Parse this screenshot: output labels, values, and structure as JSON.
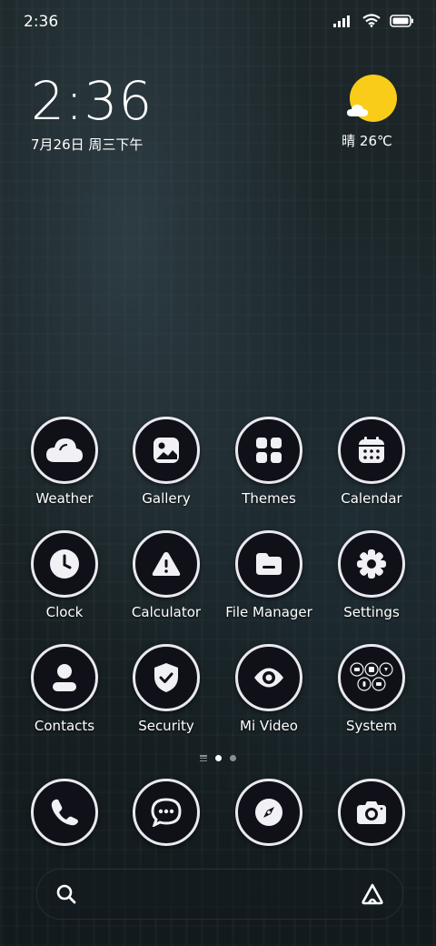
{
  "status_bar": {
    "time": "2:36",
    "icons": [
      "signal-icon",
      "wifi-icon",
      "battery-icon"
    ]
  },
  "clock_widget": {
    "time": "2:36",
    "date": "7月26日 周三下午"
  },
  "weather_widget": {
    "icon": "sunny-partly-cloudy-icon",
    "text": "晴 26℃",
    "sun_color": "#f8cc19"
  },
  "apps": [
    {
      "label": "Weather",
      "icon": "weather-icon"
    },
    {
      "label": "Gallery",
      "icon": "gallery-icon"
    },
    {
      "label": "Themes",
      "icon": "themes-icon"
    },
    {
      "label": "Calendar",
      "icon": "calendar-icon"
    },
    {
      "label": "Clock",
      "icon": "clock-icon"
    },
    {
      "label": "Calculator",
      "icon": "calculator-icon"
    },
    {
      "label": "File Manager",
      "icon": "file-manager-icon"
    },
    {
      "label": "Settings",
      "icon": "settings-icon"
    },
    {
      "label": "Contacts",
      "icon": "contacts-icon"
    },
    {
      "label": "Security",
      "icon": "security-icon"
    },
    {
      "label": "Mi Video",
      "icon": "mi-video-icon"
    },
    {
      "label": "System",
      "icon": "system-folder-icon"
    }
  ],
  "page_indicator": {
    "pages": 2,
    "current": 1
  },
  "dock": [
    {
      "icon": "phone-icon"
    },
    {
      "icon": "messages-icon"
    },
    {
      "icon": "browser-icon"
    },
    {
      "icon": "camera-icon"
    }
  ],
  "search_bar": {
    "left_icon": "search-icon",
    "right_icon": "assistant-icon"
  },
  "colors": {
    "icon_background": "#0f1018",
    "icon_border": "#e9e9ef",
    "sun": "#f8cc19"
  }
}
